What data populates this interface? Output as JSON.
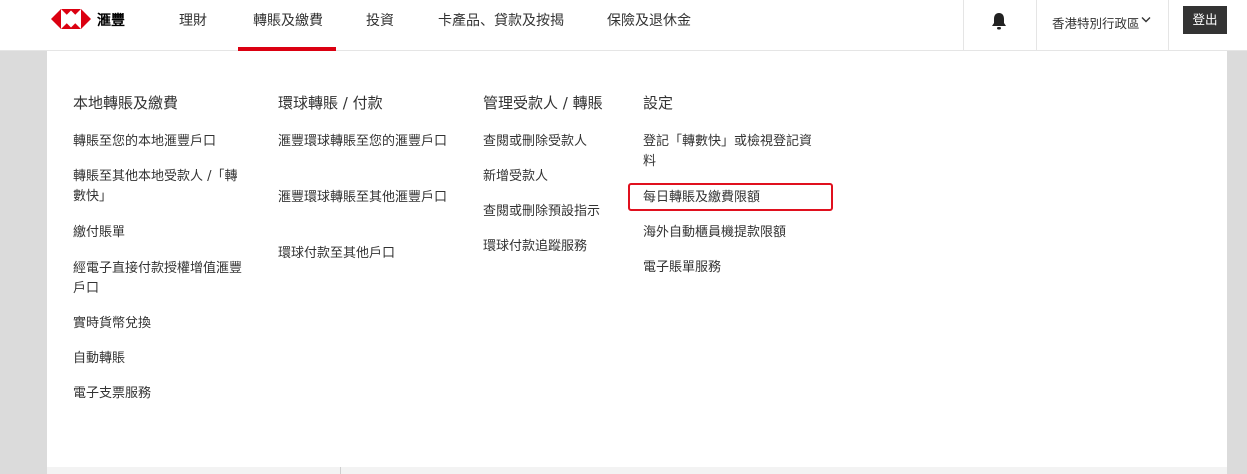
{
  "brand": {
    "name": "滙豐",
    "accent": "#db0011"
  },
  "nav": {
    "items": [
      {
        "label": "理財"
      },
      {
        "label": "轉賬及繳費"
      },
      {
        "label": "投資"
      },
      {
        "label": "卡產品、貸款及按揭"
      },
      {
        "label": "保險及退休金"
      }
    ],
    "region": "香港特別行政區",
    "logout": "登出"
  },
  "menu": {
    "columns": [
      {
        "title": "本地轉賬及繳費",
        "links": [
          "轉賬至您的本地滙豐戶口",
          "轉賬至其他本地受款人 /「轉數快」",
          "繳付賬單",
          "經電子直接付款授權增值滙豐戶口",
          "實時貨幣兌換",
          "自動轉賬",
          "電子支票服務"
        ]
      },
      {
        "title": "環球轉賬 / 付款",
        "links": [
          "滙豐環球轉賬至您的滙豐戶口",
          "滙豐環球轉賬至其他滙豐戶口",
          "環球付款至其他戶口"
        ]
      },
      {
        "title": "管理受款人 / 轉賬",
        "links": [
          "查閱或刪除受款人",
          "新增受款人",
          "查閱或刪除預設指示",
          "環球付款追蹤服務"
        ]
      },
      {
        "title": "設定",
        "links": [
          "登記「轉數快」或檢視登記資料",
          "每日轉賬及繳費限額",
          "海外自動櫃員機提款限額",
          "電子賬單服務"
        ]
      }
    ]
  }
}
